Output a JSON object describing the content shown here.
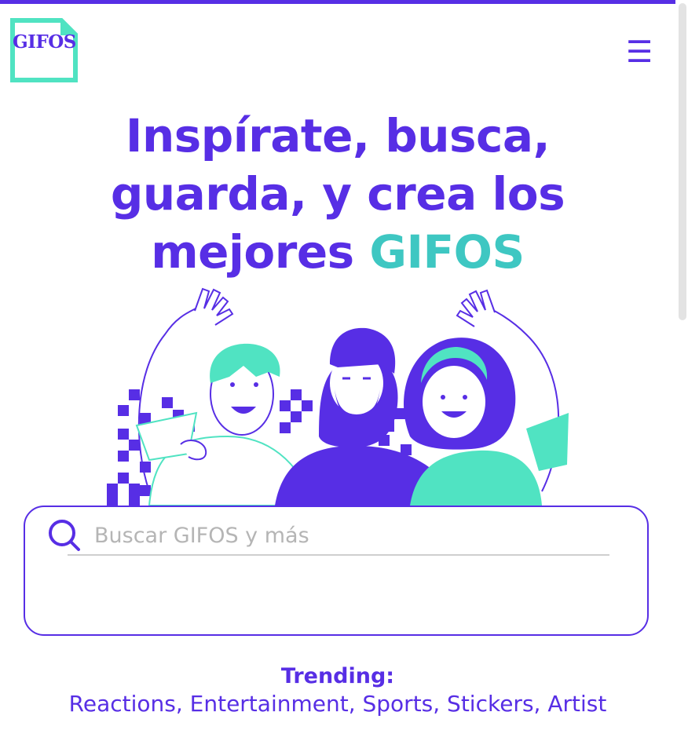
{
  "header": {
    "logo_text": "GIFOS",
    "menu_icon": "hamburger-icon",
    "menu_symbol": "☰"
  },
  "hero": {
    "headline_main": "Inspírate, busca, guarda, y crea los mejores ",
    "headline_accent": "GIFOS"
  },
  "search": {
    "placeholder": "Buscar GIFOS y más",
    "value": "",
    "icon": "search-icon"
  },
  "trending": {
    "title": "Trending:",
    "items": "Reactions, Entertainment, Sports, Stickers, Artist"
  },
  "colors": {
    "primary": "#572ee5",
    "accent": "#50e3c2",
    "placeholder": "#b5b5b5"
  }
}
